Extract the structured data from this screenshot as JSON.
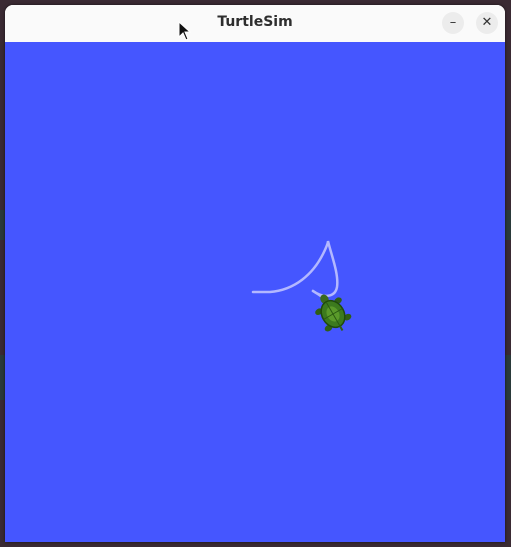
{
  "window": {
    "title": "TurtleSim",
    "minimize_label": "–",
    "close_label": "✕"
  },
  "canvas": {
    "background_color": "#4556ff",
    "pen_color": "#b3b8ff"
  },
  "turtle": {
    "icon": "turtle-icon",
    "color": "#3c7a1e"
  },
  "cursor": {
    "icon": "mouse-pointer-icon"
  }
}
